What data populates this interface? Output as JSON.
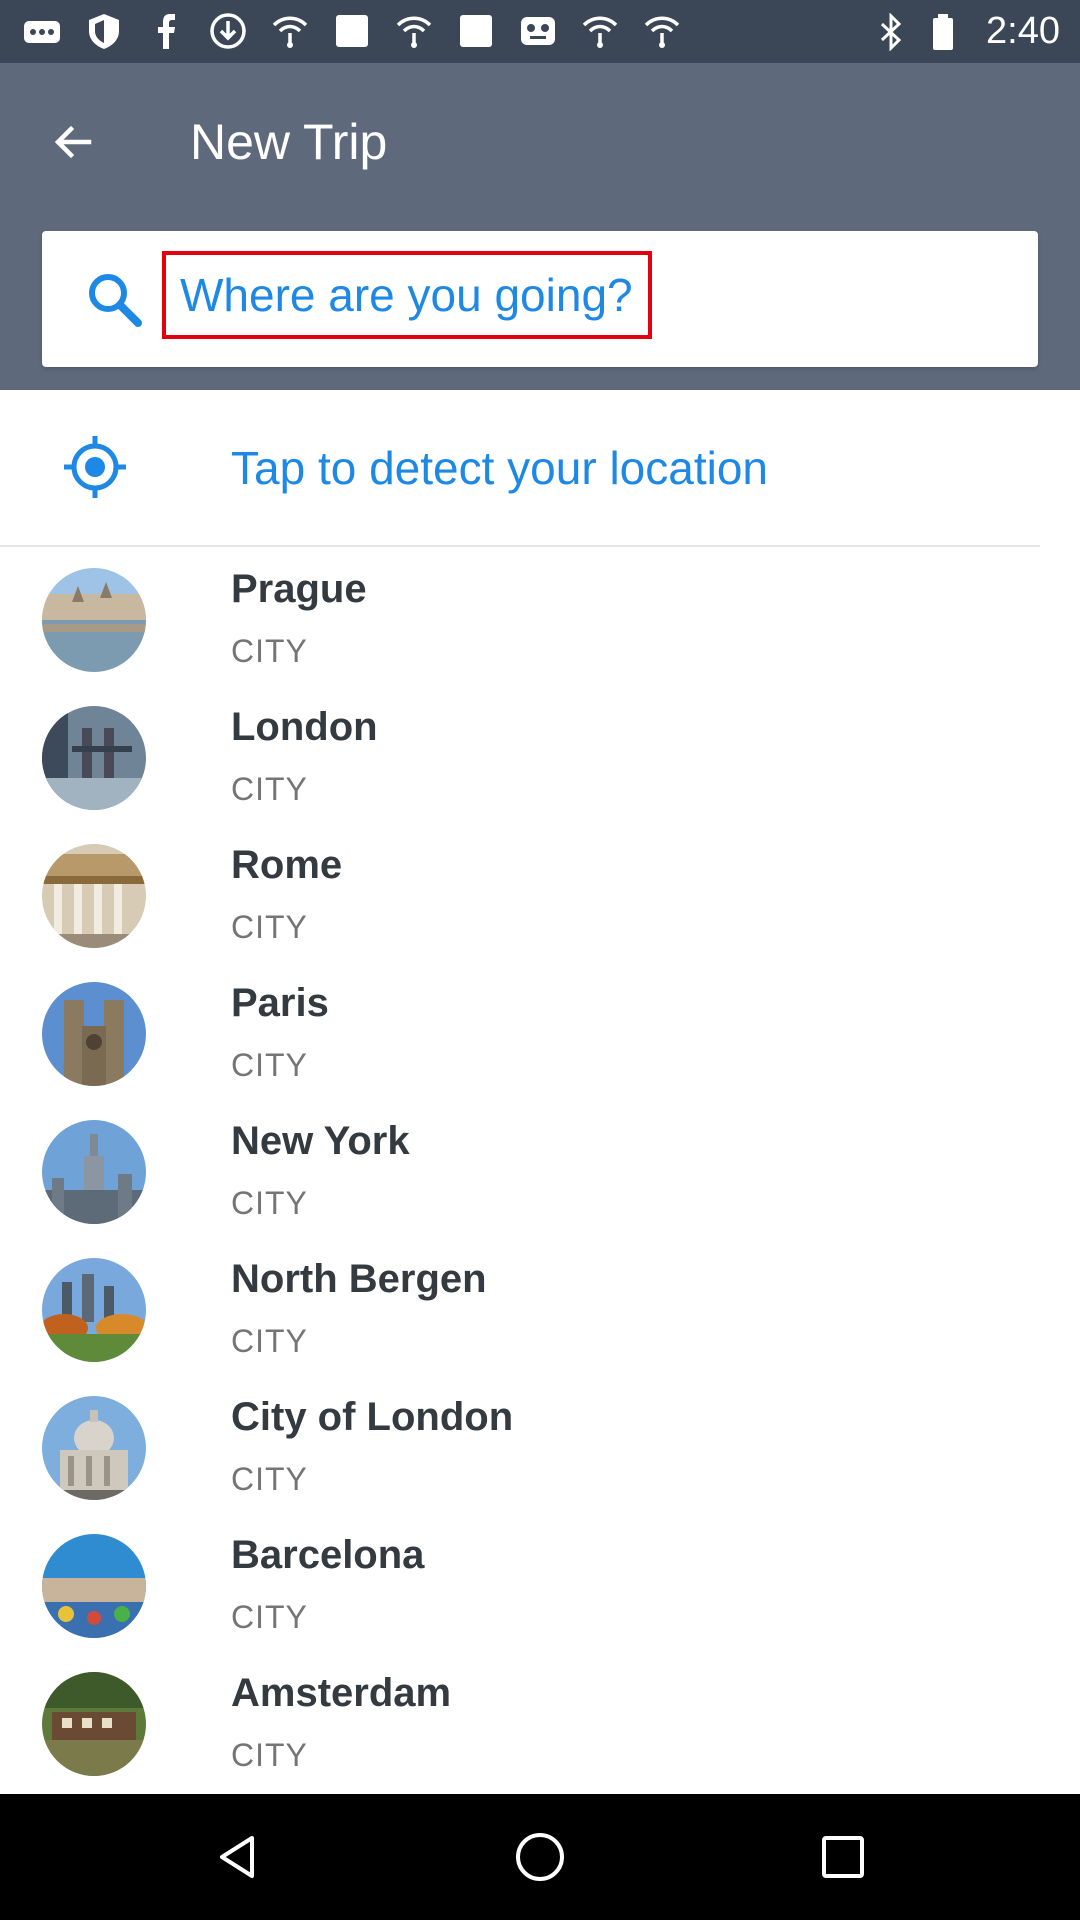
{
  "status_bar": {
    "time": "2:40",
    "left_icons": [
      "dots-icon",
      "shield-icon",
      "facebook-icon",
      "download-icon",
      "wifi-icon",
      "square-icon",
      "wifi-icon",
      "square-icon",
      "game-icon",
      "wifi-icon",
      "wifi-icon"
    ],
    "right_icons": [
      "bluetooth-icon",
      "battery-icon"
    ]
  },
  "header": {
    "title": "New Trip",
    "back_icon": "arrow-back-icon"
  },
  "search": {
    "placeholder": "Where are you going?",
    "value": "",
    "icon": "search-icon"
  },
  "detect_location": {
    "label": "Tap to detect your location",
    "icon": "target-icon"
  },
  "colors": {
    "status_bar": "#3b4756",
    "app_bar": "#5e6a7c",
    "accent": "#1e88e5",
    "highlight_border": "#e3000f"
  },
  "cities": [
    {
      "name": "Prague",
      "type": "CITY"
    },
    {
      "name": "London",
      "type": "CITY"
    },
    {
      "name": "Rome",
      "type": "CITY"
    },
    {
      "name": "Paris",
      "type": "CITY"
    },
    {
      "name": "New York",
      "type": "CITY"
    },
    {
      "name": "North Bergen",
      "type": "CITY"
    },
    {
      "name": "City of London",
      "type": "CITY"
    },
    {
      "name": "Barcelona",
      "type": "CITY"
    },
    {
      "name": "Amsterdam",
      "type": "CITY"
    }
  ],
  "nav_bar": {
    "buttons": [
      "back-triangle-icon",
      "home-circle-icon",
      "recents-square-icon"
    ]
  }
}
